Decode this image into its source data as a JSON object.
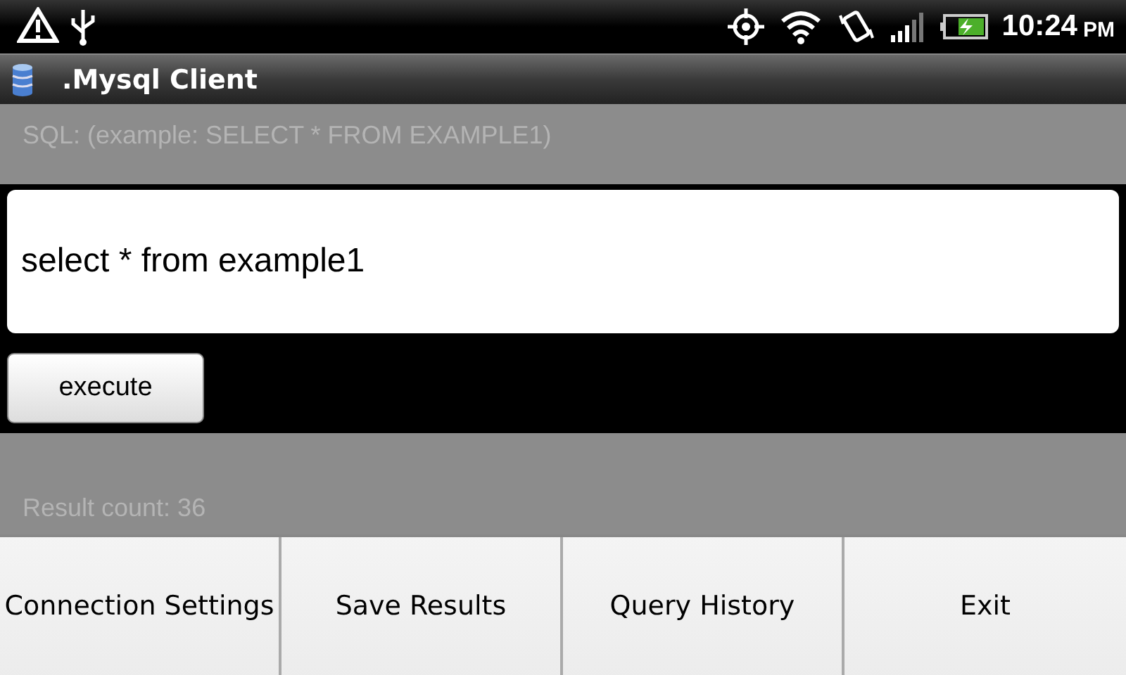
{
  "status_bar": {
    "time": "10:24",
    "ampm": "PM"
  },
  "window": {
    "title": ".Mysql Client"
  },
  "sql_label": "SQL: (example: SELECT * FROM EXAMPLE1)",
  "sql_field": {
    "value": "select * from example1"
  },
  "execute_button": "execute",
  "result_count": "Result count: 36",
  "menu": [
    "Connection Settings",
    "Save Results",
    "Query History",
    "Exit"
  ]
}
